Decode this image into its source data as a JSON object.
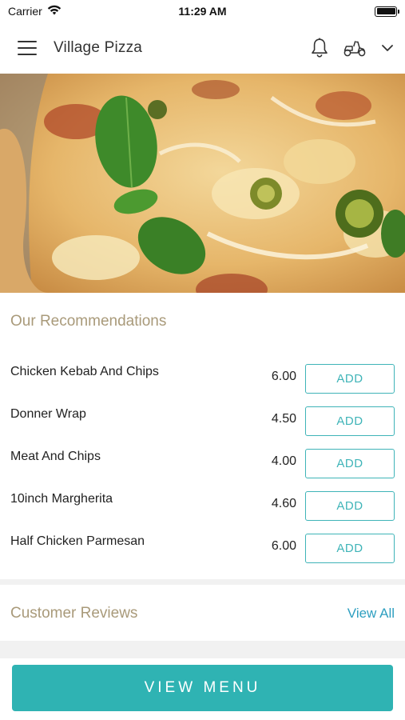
{
  "status_bar": {
    "carrier": "Carrier",
    "time": "11:29 AM"
  },
  "header": {
    "title": "Village Pizza",
    "icons": [
      "menu-icon",
      "bell-icon",
      "scooter-icon",
      "chevron-down-icon"
    ]
  },
  "hero": {
    "image": "pizza-photo"
  },
  "recommendations": {
    "title": "Our Recommendations",
    "add_label": "ADD",
    "items": [
      {
        "name": "Chicken Kebab And Chips",
        "price": "6.00"
      },
      {
        "name": "Donner Wrap",
        "price": "4.50"
      },
      {
        "name": "Meat And Chips",
        "price": "4.00"
      },
      {
        "name": "10inch Margherita",
        "price": "4.60"
      },
      {
        "name": "Half Chicken Parmesan",
        "price": "6.00"
      }
    ]
  },
  "reviews": {
    "title": "Customer Reviews",
    "view_all": "View All"
  },
  "cta": {
    "label": "VIEW MENU"
  },
  "colors": {
    "accent": "#2fb3b3",
    "section_title": "#a99a7a",
    "link": "#2e9fc0"
  }
}
